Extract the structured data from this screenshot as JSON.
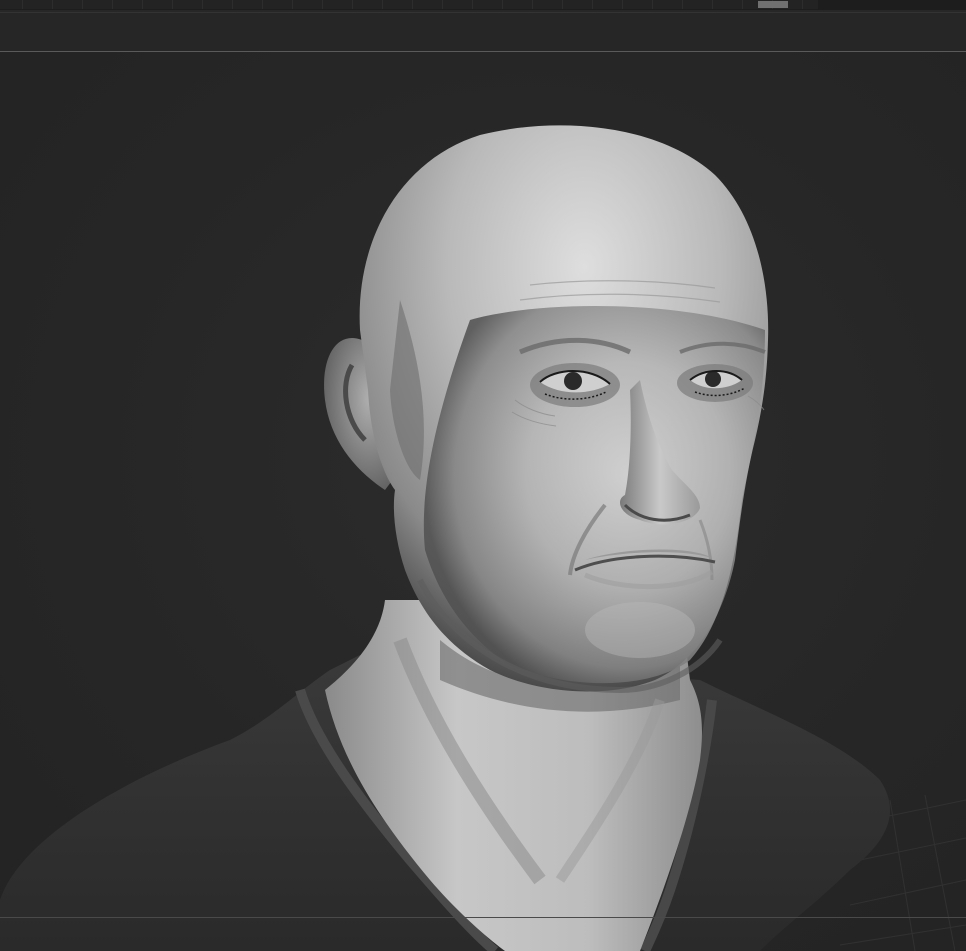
{
  "app": {
    "viewport_model": "sculpted-male-head-bust",
    "material_colors": {
      "clay_light": "#cfcfcf",
      "clay_mid": "#9a9a9a",
      "clay_dark": "#3a3a3a",
      "shirt": "#343434",
      "background": "#272727"
    }
  },
  "top_slider": {
    "value_fraction": 0.93
  },
  "icons": {
    "slider_thumb": "slider-thumb-icon"
  }
}
